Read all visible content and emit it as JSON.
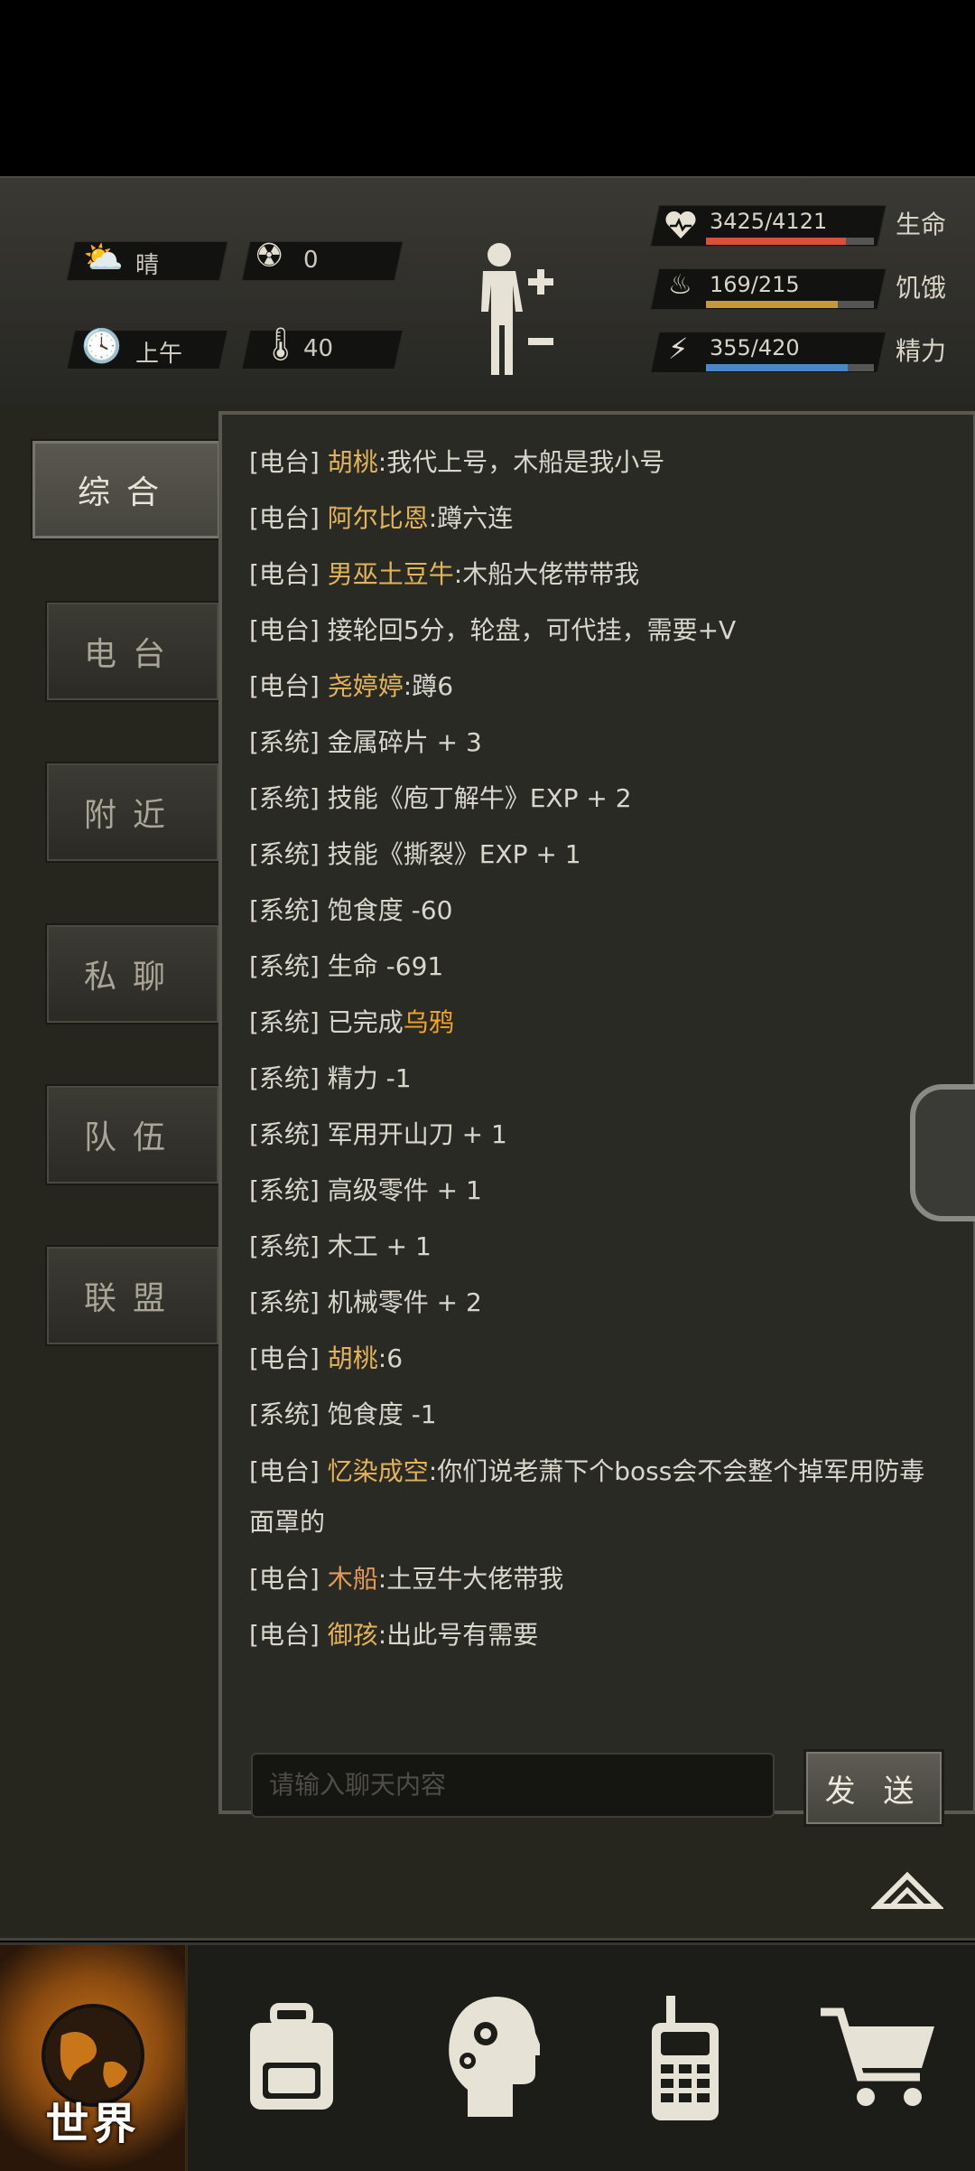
{
  "hud": {
    "weather": "晴",
    "radiation": "0",
    "time_of_day": "上午",
    "temperature": "40",
    "stats": [
      {
        "label": "生命",
        "value": "3425/4121",
        "fraction": 0.831,
        "color": "#d9503a"
      },
      {
        "label": "饥饿",
        "value": "169/215",
        "fraction": 0.786,
        "color": "#c9963a"
      },
      {
        "label": "精力",
        "value": "355/420",
        "fraction": 0.845,
        "color": "#4a86c8"
      }
    ],
    "icons": [
      "weather-sun-cloud-icon",
      "radiation-icon",
      "clock-icon",
      "thermometer-icon",
      "body-status-icon",
      "heart-icon",
      "stomach-icon",
      "energy-head-icon"
    ]
  },
  "tabs": [
    "综合",
    "电台",
    "附近",
    "私聊",
    "队伍",
    "联盟"
  ],
  "chat": {
    "messages": [
      {
        "ch": "[电台]",
        "name": "胡桃",
        "text": ":我代上号，木船是我小号",
        "name_color": "gold"
      },
      {
        "ch": "[电台]",
        "name": "阿尔比恩",
        "text": ":蹲六连",
        "name_color": "gold"
      },
      {
        "ch": "[电台]",
        "name": "男巫土豆牛",
        "text": ":木船大佬带带我",
        "name_color": "gold"
      },
      {
        "ch": "[电台]",
        "name": "",
        "text": "接轮回5分，轮盘，可代挂，需要+V",
        "name_color": "gold"
      },
      {
        "ch": "[电台]",
        "name": "尧婷婷",
        "text": ":蹲6",
        "name_color": "gold"
      },
      {
        "ch": "[系统]",
        "name": "",
        "text": "金属碎片 + 3"
      },
      {
        "ch": "[系统]",
        "name": "",
        "text": "技能《庖丁解牛》EXP + 2"
      },
      {
        "ch": "[系统]",
        "name": "",
        "text": "技能《撕裂》EXP + 1"
      },
      {
        "ch": "[系统]",
        "name": "",
        "text": "饱食度 -60"
      },
      {
        "ch": "[系统]",
        "name": "",
        "text": "生命 -691"
      },
      {
        "ch": "[系统]",
        "name": "",
        "text": "已完成",
        "highlight": "乌鸦"
      },
      {
        "ch": "[系统]",
        "name": "",
        "text": "精力 -1"
      },
      {
        "ch": "[系统]",
        "name": "",
        "text": "军用开山刀 + 1"
      },
      {
        "ch": "[系统]",
        "name": "",
        "text": "高级零件 + 1"
      },
      {
        "ch": "[系统]",
        "name": "",
        "text": "木工 + 1"
      },
      {
        "ch": "[系统]",
        "name": "",
        "text": "机械零件 + 2"
      },
      {
        "ch": "[电台]",
        "name": "胡桃",
        "text": ":6",
        "name_color": "gold"
      },
      {
        "ch": "[系统]",
        "name": "",
        "text": "饱食度 -1"
      },
      {
        "ch": "[电台]",
        "name": "忆染成空",
        "text": ":你们说老萧下个boss会不会整个掉军用防毒面罩的",
        "name_color": "gold",
        "wrap": true
      },
      {
        "ch": "[电台]",
        "name": "木船",
        "text": ":土豆牛大佬带我",
        "name_color": "orange"
      },
      {
        "ch": "[电台]",
        "name": "御孩",
        "text": ":出此号有需要",
        "name_color": "gold"
      }
    ],
    "input_placeholder": "请输入聊天内容",
    "send_label": "发 送"
  },
  "nav": {
    "items": [
      {
        "name": "world",
        "label": "世界",
        "icon": "globe-icon",
        "active": true
      },
      {
        "name": "backpack",
        "label": "",
        "icon": "backpack-icon"
      },
      {
        "name": "skills",
        "label": "",
        "icon": "head-gears-icon"
      },
      {
        "name": "radio",
        "label": "",
        "icon": "walkie-talkie-icon"
      },
      {
        "name": "shop",
        "label": "",
        "icon": "shopping-cart-icon"
      }
    ]
  }
}
